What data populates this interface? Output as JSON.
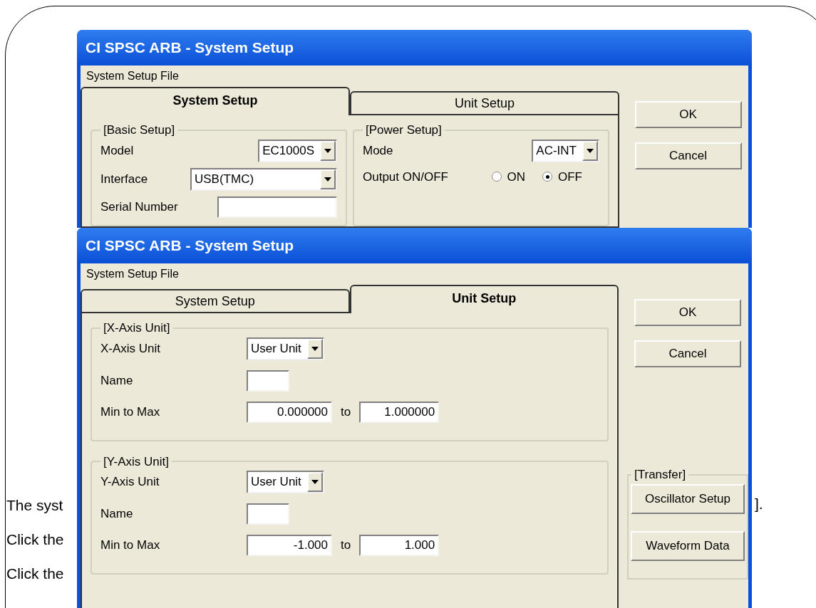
{
  "document": {
    "left_fragments": [
      "The syst",
      "Click the",
      "Click the"
    ],
    "right_fragment": "]."
  },
  "windows": [
    {
      "title": "CI SPSC ARB - System Setup",
      "menu": [
        "System Setup File"
      ],
      "kind": "columns",
      "tabs": [
        {
          "label": "System Setup",
          "selected": true
        },
        {
          "label": "Unit Setup",
          "selected": false
        }
      ],
      "buttons": [
        "OK",
        "Cancel"
      ],
      "groups": [
        {
          "title": "[Basic Setup]",
          "rows": [
            {
              "kind": "select",
              "label": "Model",
              "value": "EC1000S"
            },
            {
              "kind": "select",
              "label": "Interface",
              "value": "USB(TMC)"
            },
            {
              "kind": "input",
              "label": "Serial Number"
            }
          ]
        },
        {
          "title": "[Power Setup]",
          "rows": [
            {
              "kind": "select",
              "label": "Mode",
              "value": "AC-INT"
            },
            {
              "kind": "radio",
              "label": "Output ON/OFF",
              "options": [
                {
                  "label": "ON",
                  "selected": false
                },
                {
                  "label": "OFF",
                  "selected": true
                }
              ]
            }
          ]
        }
      ]
    },
    {
      "title": "CI SPSC ARB - System Setup",
      "menu": [
        "System Setup File"
      ],
      "kind": "stack",
      "tabs": [
        {
          "label": "System Setup",
          "selected": false
        },
        {
          "label": "Unit Setup",
          "selected": true
        }
      ],
      "buttons": [
        "OK",
        "Cancel"
      ],
      "groups": [
        {
          "title": "[X-Axis Unit]",
          "rows": [
            {
              "kind": "select",
              "label": "X-Axis Unit",
              "value": "User Unit"
            },
            {
              "kind": "input",
              "label": "Name"
            },
            {
              "kind": "range",
              "label": "Min to Max",
              "min": "0.000000",
              "connector": "to",
              "max": "1.000000"
            }
          ]
        },
        {
          "title": "[Y-Axis Unit]",
          "rows": [
            {
              "kind": "select",
              "label": "Y-Axis Unit",
              "value": "User Unit"
            },
            {
              "kind": "input",
              "label": "Name"
            },
            {
              "kind": "range",
              "label": "Min to Max",
              "min": "-1.000",
              "connector": "to",
              "max": "1.000"
            }
          ]
        }
      ],
      "transfer": {
        "title": "[Transfer]",
        "buttons": [
          "Oscillator Setup",
          "Waveform Data"
        ]
      }
    }
  ]
}
